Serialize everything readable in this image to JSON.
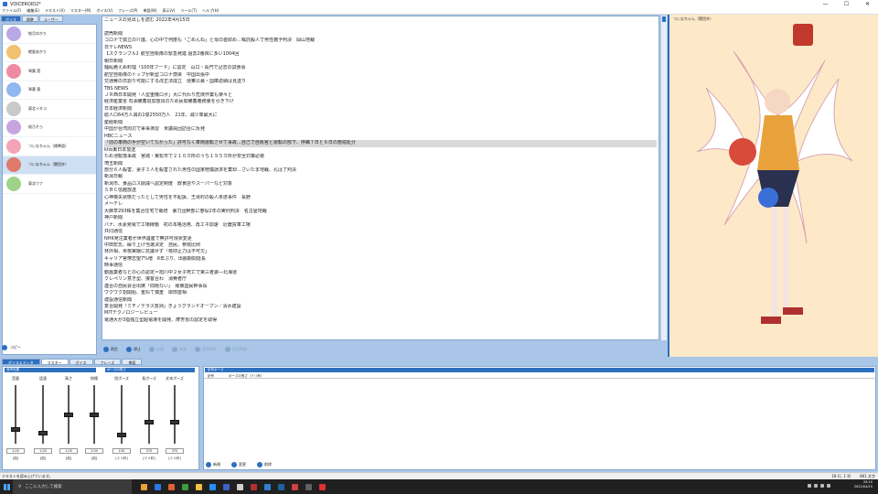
{
  "window": {
    "title": "VOICEROID2*",
    "controls": [
      "—",
      "☐",
      "✕"
    ]
  },
  "menu": [
    "ファイル(F)",
    "編集(E)",
    "テキスト(X)",
    "マスター(M)",
    "ボイス(V)",
    "フレーズ(P)",
    "単語(W)",
    "表示(V)",
    "ツール(T)",
    "ヘルプ(H)"
  ],
  "left_tabs": [
    "ボイス",
    "標準",
    "ユーザー"
  ],
  "voices": [
    {
      "name": "結月ゆかり",
      "color": "#b9a7e6"
    },
    {
      "name": "紲星あかり",
      "color": "#f2c16f"
    },
    {
      "name": "琴葉 茜",
      "color": "#f08aa0"
    },
    {
      "name": "琴葉 葵",
      "color": "#8fb8f0"
    },
    {
      "name": "東北イタコ",
      "color": "#c9c9c9"
    },
    {
      "name": "桜乃そら",
      "color": "#c7a6e0"
    },
    {
      "name": "ついなちゃん（標準語）",
      "color": "#f4a4b8"
    },
    {
      "name": "ついなちゃん（関西弁）",
      "color": "#e07a6a"
    },
    {
      "name": "東北ウナ",
      "color": "#9fd38a"
    }
  ],
  "selected_voice_index": 7,
  "copy_label": "コピー",
  "text_lines": [
    "ニュースの見出しを読む 2022年4月15日",
    "",
    "読売新聞",
    "コロナで孤立の介護、心の中で何度も「ごめんね」と母の首絞め…嘱託殺人で男性猶予判決　岡山地裁",
    "日テレNEWS",
    "【スクランブル】航空自衛隊の緊急発進 過去2番目に多い1004回",
    "朝日新聞",
    "騒乱絶えぬ料理「100年フード」に認定　山口・長門で記念の試食会",
    "航空自衛隊のトップが新型コロナ感染　中国出張中",
    "交通費の日割り可能にする改正法成立　便乗公募・国庫返納は見送り",
    "TBS NEWS",
    "ＪＲ西日本開発「人型重機ロボ」大に代わり危険作業も楽々と",
    "経済産業省 石油備蓄追加放出のため民間備蓄義務量を引き下げ",
    "日本経済新聞",
    "総人口64万人減の1億2550万人　21年、減少率最大に",
    "産経新聞",
    "中国が台湾周辺で軍事演習　米議員団訪台に反発",
    "HBCニュース",
    "「前の車両の手が空いてなかった」許可なく車両運転させて事故…自己で自衛官と運転の部下、停職７日と６日の懲戒処分",
    "khb東日本放送",
    "ため池転落事故　宮城・東松市で２１０カ所のうち１９５カ所が安全対策必要",
    "埼玉新聞",
    "部分６人殺害、妻子３人を殺害された男性の国家賠償請求を棄却…さいたま地裁、孔は了判決",
    "新潟日報",
    "新潟市、食品ロス削減へ認定制度　飲食店やスーパーなど対象",
    "ＳＢＣ信越放送",
    "心神喪失状態だったとして男性を不起訴、王滝村の殺人未遂事件　長野",
    "メ～テレ",
    "大麻草293株を集合住宅で栽培　暴力団幹部に懲役2年の実刑判決　名古屋地裁",
    "神戸新聞",
    "バナ、水素発電で工場稼働　初の本格活用、再エネ加速　近畿貨車工場",
    "共同通信",
    "NHK発注業者が世界遺産で無許可現状変更",
    "中田宏氏、繰り上げ当選決定　自民、参院比例",
    "林外相、米核実験に抗議せず「核抑止力は不可欠」",
    "キャリア官僚志望7%増　6年ぶり、出願期間延長",
    "時事通信",
    "動画業者などの心の認定＝旭川中２女子死亡で第三者委―北海道",
    "クレペリン意き型、接客合わ　消費者庁",
    "連合の自民会合出席「問題ない」　様東国民幹事長",
    "ワクワク割関始、重ねて慎重　岸田首相",
    "建設通信新聞",
    "复合開発「ミチノテラス豊洲」きょうグランドオープン／清水建設",
    "MITテクノロジーレビュー",
    "電通大が3指独立型超電導を開発、摩芳省の認定を取得"
  ],
  "highlight_line_index": 18,
  "play_controls": [
    {
      "label": "再生",
      "enabled": true
    },
    {
      "label": "停止",
      "enabled": true
    },
    {
      "label": "先頭",
      "enabled": false
    },
    {
      "label": "末尾",
      "enabled": false
    },
    {
      "label": "音声保存",
      "enabled": false
    },
    {
      "label": "再生時間",
      "enabled": false
    }
  ],
  "character_label": "ついなちゃん（関西弁）",
  "bottom_tabs": [
    "ボイスエディタ",
    "マスター",
    "ボイス",
    "フレーズ",
    "単語"
  ],
  "params": {
    "header_basic": "音声効果",
    "header_pause": "ポーズの長さ",
    "sliders": [
      {
        "label": "音量",
        "value": "1.00",
        "unit": "[倍]",
        "level": 0.25
      },
      {
        "label": "話速",
        "value": "1.00",
        "unit": "[倍]",
        "level": 0.18
      },
      {
        "label": "高さ",
        "value": "1.00",
        "unit": "[倍]",
        "level": 0.5
      },
      {
        "label": "抑揚",
        "value": "1.00",
        "unit": "[倍]",
        "level": 0.5
      },
      {
        "label": "短ポーズ",
        "value": "150",
        "unit": "[ミリ秒]",
        "level": 0.15
      },
      {
        "label": "長ポーズ",
        "value": "370",
        "unit": "[ミリ秒]",
        "level": 0.37
      },
      {
        "label": "文末ポーズ",
        "value": "370",
        "unit": "[ミリ秒]",
        "level": 0.37
      }
    ]
  },
  "word_panel": {
    "header": "記号ポーズ",
    "columns": [
      "記号",
      "ポーズの長さ（ミリ秒）"
    ],
    "buttons": [
      "新規",
      "変更",
      "削除"
    ]
  },
  "status": {
    "message": "テキストを読み上げています。",
    "position": "18 行, 1 列",
    "chars": "861 文字"
  },
  "taskbar": {
    "search_placeholder": "ここに入力して検索",
    "time": "20:10",
    "date": "2022/04/15",
    "app_colors": [
      "#e8a13a",
      "#2b78e4",
      "#e06030",
      "#3a9b3a",
      "#f0c040",
      "#1e90ff",
      "#4060c0",
      "#d0d0d0",
      "#b03030",
      "#3080d0",
      "#2060a0",
      "#d04040",
      "#606060",
      "#e03030"
    ]
  }
}
